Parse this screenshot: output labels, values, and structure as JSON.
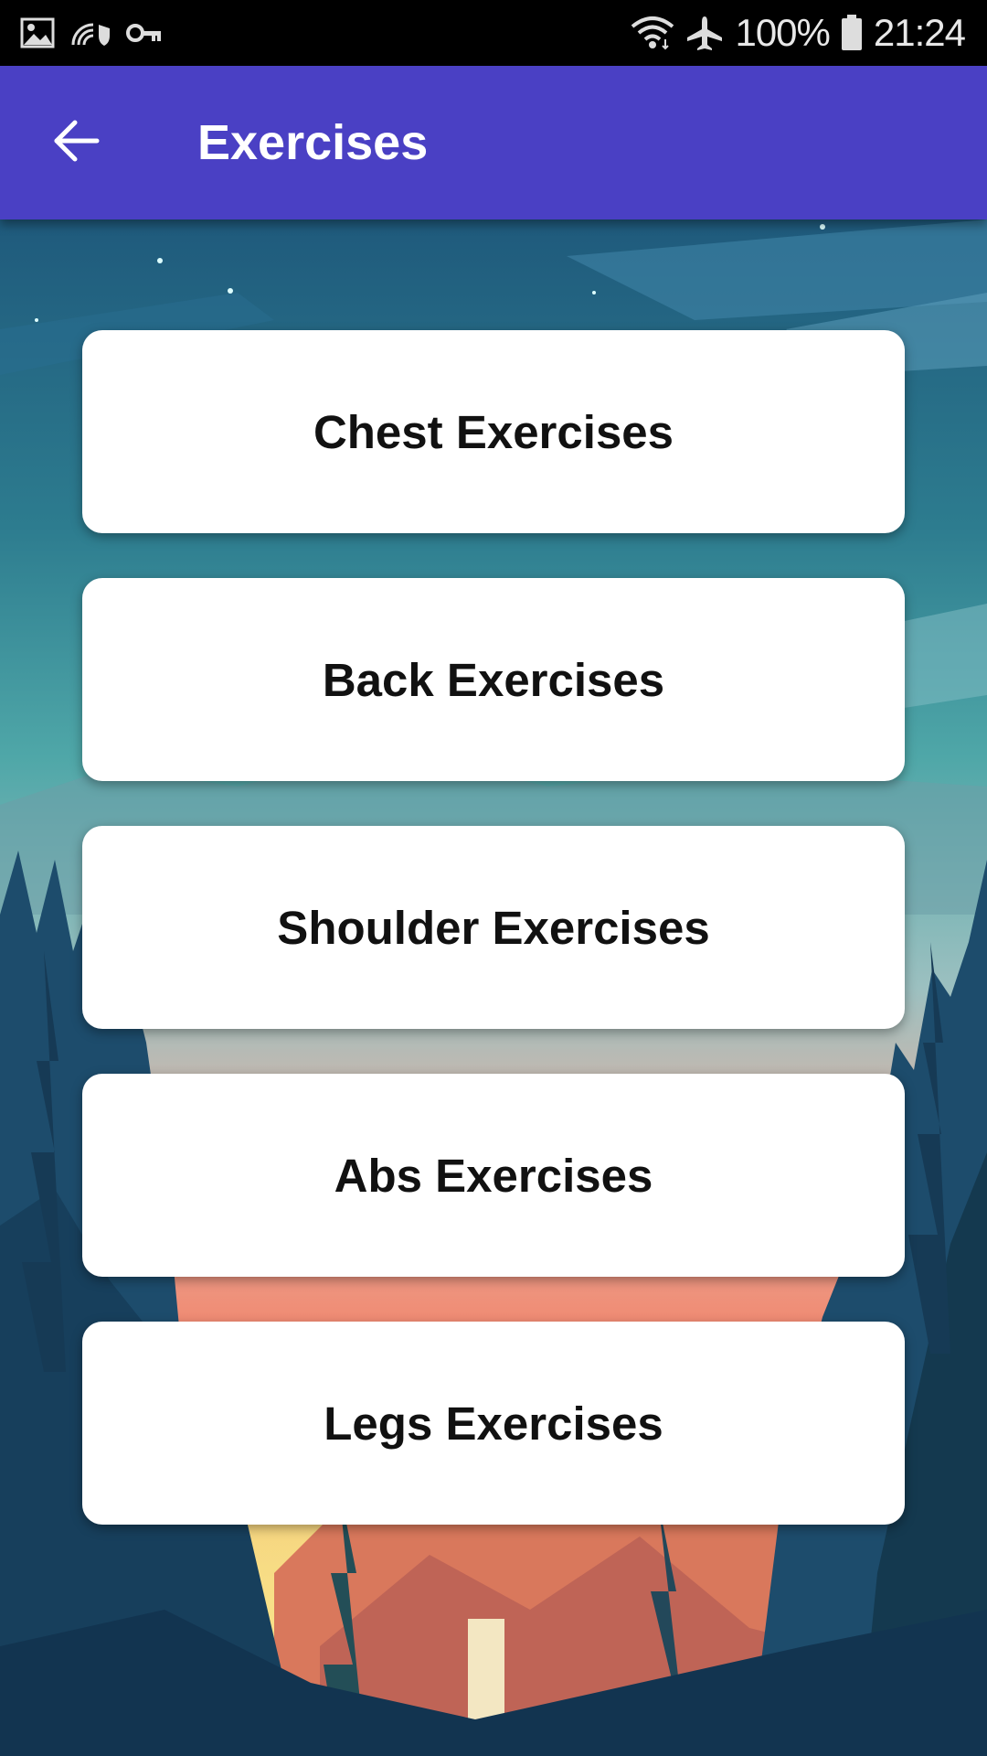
{
  "status_bar": {
    "battery_text": "100%",
    "time": "21:24",
    "icons": [
      "image-icon",
      "wifi-calling-icon",
      "key-icon",
      "wifi-icon",
      "airplane-icon",
      "battery-icon"
    ]
  },
  "app_bar": {
    "title": "Exercises",
    "back_icon": "arrow-back-icon",
    "color": "#4a40c4"
  },
  "menu": {
    "items": [
      {
        "label": "Chest Exercises"
      },
      {
        "label": "Back Exercises"
      },
      {
        "label": "Shoulder Exercises"
      },
      {
        "label": "Abs Exercises"
      },
      {
        "label": "Legs Exercises"
      }
    ]
  }
}
